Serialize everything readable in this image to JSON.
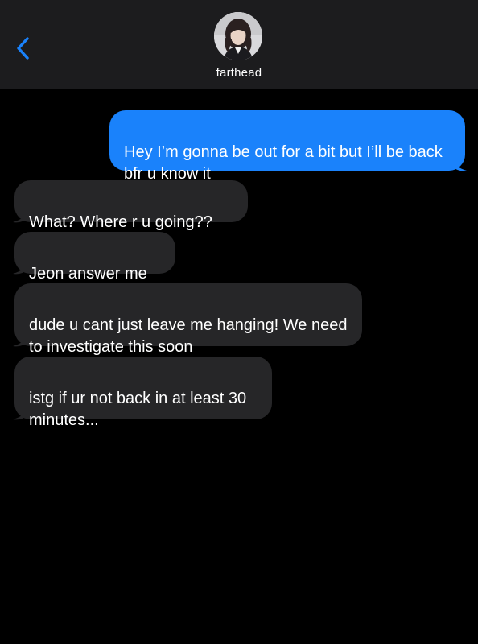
{
  "header": {
    "contact_name": "farthead",
    "back_icon": "chevron-left-icon",
    "avatar": "contact-avatar"
  },
  "colors": {
    "sent_bubble": "#1a82fb",
    "received_bubble": "#262628",
    "header_bg": "#1c1c1e",
    "accent": "#1a82fb"
  },
  "messages": [
    {
      "direction": "sent",
      "text": "Hey I’m gonna be out for a bit but I’ll be back bfr u know it"
    },
    {
      "direction": "received",
      "text": "What? Where r u going??"
    },
    {
      "direction": "received",
      "text": "Jeon answer me"
    },
    {
      "direction": "received",
      "text": "dude u cant just leave me hanging! We need to investigate this soon"
    },
    {
      "direction": "received",
      "text": "istg if ur not back in at least 30 minutes..."
    }
  ]
}
